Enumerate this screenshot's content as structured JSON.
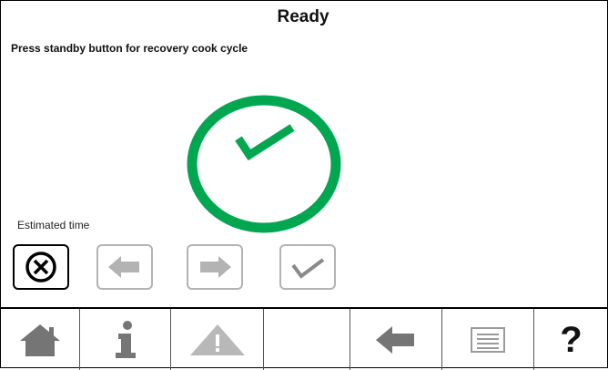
{
  "header": {
    "title": "Ready"
  },
  "status": {
    "message": "Press standby button for recovery cook cycle"
  },
  "indicator": {
    "icon": "large-green-check-icon",
    "color": "#00A650"
  },
  "estimate": {
    "label": "Estimated time"
  },
  "controls": [
    {
      "name": "cancel-button",
      "icon": "cancel-x-icon",
      "enabled": true
    },
    {
      "name": "previous-button",
      "icon": "arrow-left-icon",
      "enabled": false
    },
    {
      "name": "next-button",
      "icon": "arrow-right-icon",
      "enabled": false
    },
    {
      "name": "confirm-button",
      "icon": "check-icon",
      "enabled": false
    }
  ],
  "toolbar": [
    {
      "name": "home-button",
      "icon": "home-icon"
    },
    {
      "name": "info-button",
      "icon": "info-icon"
    },
    {
      "name": "alerts-button",
      "icon": "warning-triangle-icon"
    },
    {
      "name": "blank-button",
      "icon": ""
    },
    {
      "name": "back-button",
      "icon": "arrow-left-icon"
    },
    {
      "name": "menu-button",
      "icon": "list-icon"
    },
    {
      "name": "help-button",
      "icon": "question-mark-icon",
      "glyph": "?"
    }
  ],
  "colors": {
    "accent_green": "#00A650",
    "icon_gray": "#757575",
    "disabled_gray": "#b3b3b3"
  }
}
